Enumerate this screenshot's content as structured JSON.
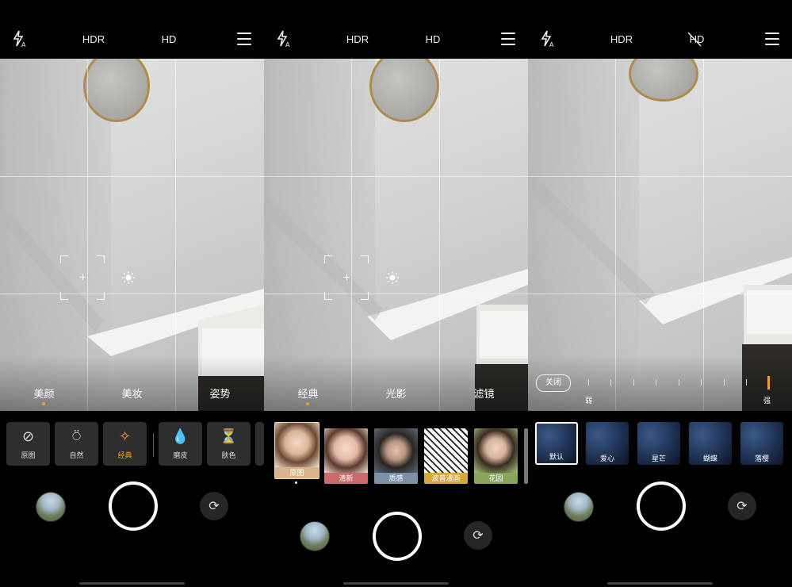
{
  "topbar": {
    "hdr": "HDR",
    "hd": "HD"
  },
  "panel1": {
    "modes": [
      "美颜",
      "美妆",
      "姿势"
    ],
    "beauty_items": [
      {
        "label": "原图",
        "icon": "⊘"
      },
      {
        "label": "自然",
        "icon": "⍥"
      },
      {
        "label": "经典",
        "icon": "✧"
      },
      {
        "label": "磨皮",
        "icon": "💧"
      },
      {
        "label": "肤色",
        "icon": "⏳"
      }
    ]
  },
  "panel2": {
    "modes": [
      "经典",
      "光影",
      "滤镜"
    ],
    "filters": [
      {
        "label": "原图",
        "color": "#d9b48a"
      },
      {
        "label": "清新",
        "color": "#c96b6b"
      },
      {
        "label": "质感",
        "color": "#7c90a8"
      },
      {
        "label": "波普漫画",
        "color": "#d6a73a"
      },
      {
        "label": "花园",
        "color": "#88a65a"
      }
    ]
  },
  "panel3": {
    "close": "关闭",
    "weak": "弱",
    "strong": "强",
    "effects": [
      "默认",
      "爱心",
      "星芒",
      "蝴蝶",
      "落樱"
    ]
  },
  "colors": {
    "accent": "#f0a030"
  }
}
